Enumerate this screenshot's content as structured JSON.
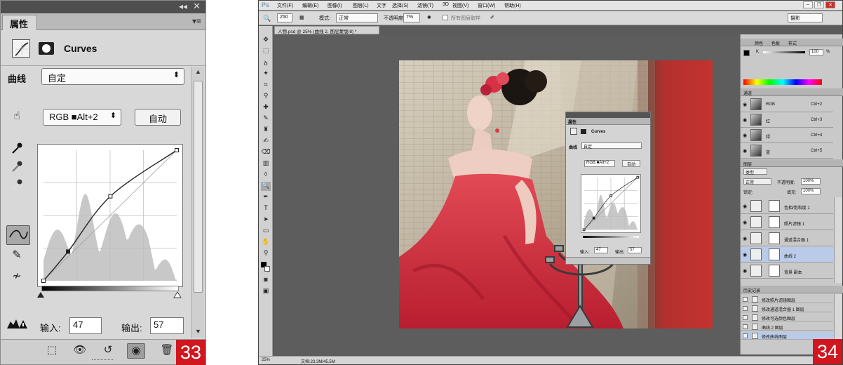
{
  "left_panel": {
    "tab_label": "属性",
    "collapse_glyph": "◂◂",
    "close_glyph": "✕",
    "menu_glyph": "▾≡",
    "adjustment_title": "Curves",
    "preset_label": "曲线",
    "preset_value": "自定",
    "channel_value": "RGB ■Alt+2",
    "auto_label": "自动",
    "input_label": "输入:",
    "input_value": "47",
    "output_label": "输出:",
    "output_value": "57",
    "badge": "33",
    "curve_points": [
      [
        0,
        0
      ],
      [
        47,
        57
      ],
      [
        128,
        165
      ],
      [
        255,
        255
      ]
    ]
  },
  "right_window": {
    "app_logo": "Ps",
    "menu": [
      "文件(F)",
      "编辑(E)",
      "图像(I)",
      "图层(L)",
      "文字",
      "选择(S)",
      "滤镜(T)",
      "3D",
      "视图(V)",
      "窗口(W)",
      "帮助(H)"
    ],
    "options": {
      "brush_size": "250",
      "mode_label": "模式:",
      "mode_value": "正常",
      "opacity_label": "不透明度:",
      "opacity_value": "7%",
      "sample_label": "所有图层取样",
      "workspace_value": "摄影"
    },
    "doc_tab": "人物.psd @ 25% (曲线 2, 图层蒙版/8) *",
    "status": {
      "zoom": "25%",
      "doc_size": "文档:23.3M/45.5M"
    },
    "badge": "34",
    "float_panel": {
      "tab_label": "属性",
      "title": "Curves",
      "preset_label": "曲线",
      "preset_value": "自定",
      "channel_value": "RGB ■Alt+2",
      "auto_label": "自动",
      "input_label": "输入:",
      "input_value": "47",
      "output_label": "输出:",
      "output_value": "57"
    },
    "color_panel": {
      "tabs": [
        "颜色",
        "色板",
        "样式"
      ],
      "k_label": "K",
      "k_value": "100",
      "unit": "%"
    },
    "channels": [
      {
        "name": "RGB",
        "shortcut": "Ctrl+2"
      },
      {
        "name": "红",
        "shortcut": "Ctrl+3"
      },
      {
        "name": "绿",
        "shortcut": "Ctrl+4"
      },
      {
        "name": "蓝",
        "shortcut": "Ctrl+5"
      }
    ],
    "channels_tab": "通道",
    "layers_tab": "图层",
    "layers_kind": "类型",
    "layers_blend": "正常",
    "layers_opacity_label": "不透明度:",
    "layers_opacity": "100%",
    "layers_lock_label": "锁定:",
    "layers_fill_label": "填充:",
    "layers_fill": "100%",
    "layers": [
      {
        "name": "色相/饱和度 1",
        "selected": false
      },
      {
        "name": "照片滤镜 1",
        "selected": false
      },
      {
        "name": "通道混合器 1",
        "selected": false
      },
      {
        "name": "曲线 2",
        "selected": true
      },
      {
        "name": "背景 副本",
        "selected": false
      }
    ],
    "history_tab": "历史记录",
    "history": [
      "修改照片滤镜图层",
      "修改通道混合器 1 图层",
      "修改可选颜色图层",
      "曲线 2 图层",
      "修改曲线图层"
    ],
    "colors": {
      "accent": "#d0161f",
      "dress": "#c8323c",
      "selected_layer": "#b9cbe8"
    }
  }
}
